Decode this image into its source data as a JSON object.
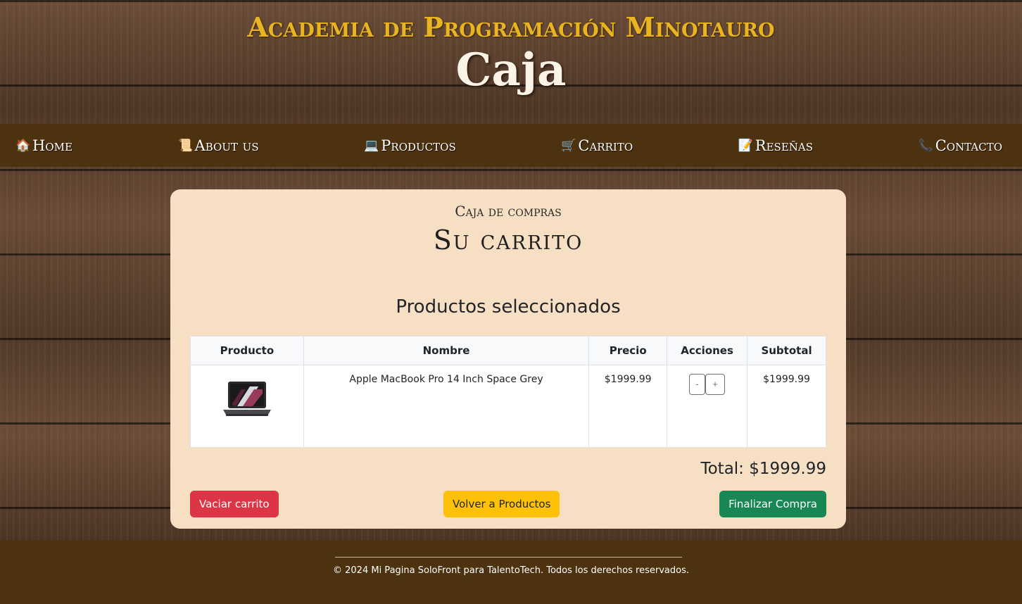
{
  "header": {
    "academy": "Academia de Programación Minotauro",
    "title": "Caja"
  },
  "nav": {
    "items": [
      {
        "label": "Home",
        "icon": "house-icon",
        "glyph": "🏠"
      },
      {
        "label": "About us",
        "icon": "scroll-icon",
        "glyph": "📜"
      },
      {
        "label": "Productos",
        "icon": "laptop-icon",
        "glyph": "💻"
      },
      {
        "label": "Carrito",
        "icon": "cart-icon",
        "glyph": "🛒"
      },
      {
        "label": "Reseñas",
        "icon": "memo-icon",
        "glyph": "📝"
      },
      {
        "label": "Contacto",
        "icon": "phone-icon",
        "glyph": "📞"
      }
    ]
  },
  "checkout": {
    "subtitle": "Caja de compras",
    "title": "Su carrito",
    "section_title": "Productos seleccionados",
    "table": {
      "headers": [
        "Producto",
        "Nombre",
        "Precio",
        "Acciones",
        "Subtotal"
      ],
      "rows": [
        {
          "image": "macbook-image",
          "name": "Apple MacBook Pro 14 Inch Space Grey",
          "price": "$1999.99",
          "minus": "-",
          "plus": "+",
          "subtotal": "$1999.99"
        }
      ]
    },
    "total": "Total: $1999.99",
    "buttons": {
      "empty": "Vaciar carrito",
      "back": "Volver a Productos",
      "finish": "Finalizar Compra"
    }
  },
  "footer": {
    "text": "© 2024 Mi Pagina SoloFront para TalentoTech. Todos los derechos reservados."
  },
  "colors": {
    "nav_bg": "#4d3210",
    "card_bg": "#f6dfc2",
    "academy_gold": "#e8b422",
    "danger": "#dc3545",
    "warning": "#ffc107",
    "success": "#198754"
  }
}
